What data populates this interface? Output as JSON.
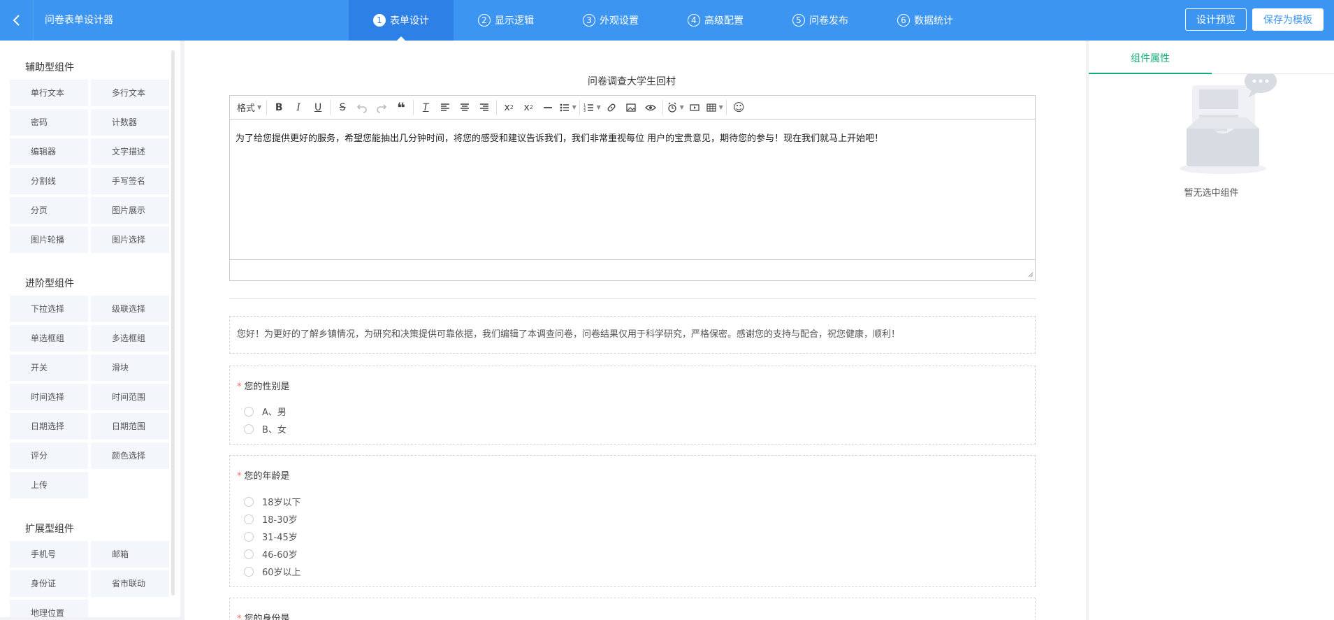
{
  "header": {
    "back_icon": "chevron-left-icon",
    "title": "问卷表单设计器",
    "steps": [
      {
        "num": "1",
        "label": "表单设计"
      },
      {
        "num": "2",
        "label": "显示逻辑"
      },
      {
        "num": "3",
        "label": "外观设置"
      },
      {
        "num": "4",
        "label": "高级配置"
      },
      {
        "num": "5",
        "label": "问卷发布"
      },
      {
        "num": "6",
        "label": "数据统计"
      }
    ],
    "active_step": 0,
    "preview_label": "设计预览",
    "save_label": "保存为模板",
    "accent": "#3c95f0"
  },
  "left_panel": {
    "groups": [
      {
        "title": "辅助型组件",
        "items": [
          "单行文本",
          "多行文本",
          "密码",
          "计数器",
          "编辑器",
          "文字描述",
          "分割线",
          "手写签名",
          "分页",
          "图片展示",
          "图片轮播",
          "图片选择"
        ]
      },
      {
        "title": "进阶型组件",
        "items": [
          "下拉选择",
          "级联选择",
          "单选框组",
          "多选框组",
          "开关",
          "滑块",
          "时间选择",
          "时间范围",
          "日期选择",
          "日期范围",
          "评分",
          "颜色选择",
          "上传"
        ]
      },
      {
        "title": "扩展型组件",
        "items": [
          "手机号",
          "邮箱",
          "身份证",
          "省市联动",
          "地理位置"
        ]
      }
    ]
  },
  "canvas": {
    "survey_title": "问卷调查大学生回村",
    "editor": {
      "format_label": "格式",
      "content": "为了给您提供更好的服务，希望您能抽出几分钟时间，将您的感受和建议告诉我们，我们非常重视每位 用户的宝贵意见，期待您的参与！现在我们就马上开始吧！"
    },
    "intro": "您好！为更好的了解乡镇情况，为研究和决策提供可靠依据，我们编辑了本调查问卷，问卷结果仅用于科学研究，严格保密。感谢您的支持与配合，祝您健康，顺利！",
    "questions": [
      {
        "required": "*",
        "title": "您的性别是",
        "options": [
          "A、男",
          "B、女"
        ]
      },
      {
        "required": "*",
        "title": "您的年龄是",
        "options": [
          "18岁以下",
          "18-30岁",
          "31-45岁",
          "46-60岁",
          "60岁以上"
        ]
      },
      {
        "required": "*",
        "title": "您的身份是",
        "options": []
      }
    ]
  },
  "right_panel": {
    "tab_label": "组件属性",
    "empty_text": "暂无选中组件",
    "accent": "#13ae76"
  }
}
